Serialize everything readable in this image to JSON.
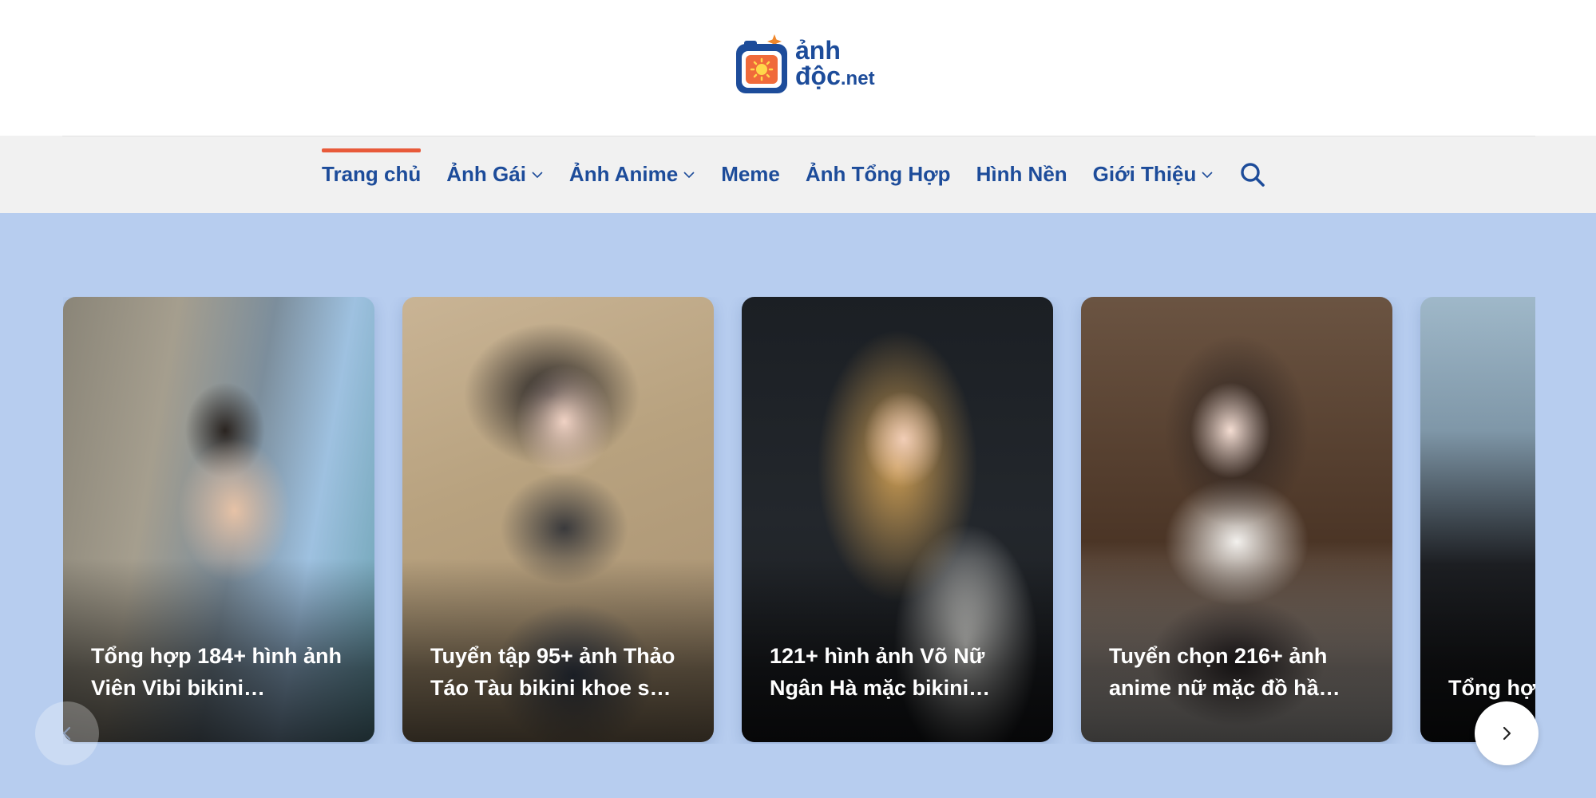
{
  "site": {
    "logo_line1": "ảnh",
    "logo_line2": "độc",
    "logo_tld": ".net"
  },
  "nav": {
    "items": [
      {
        "label": "Trang chủ",
        "active": true,
        "dropdown": false
      },
      {
        "label": "Ảnh Gái",
        "active": false,
        "dropdown": true
      },
      {
        "label": "Ảnh Anime",
        "active": false,
        "dropdown": true
      },
      {
        "label": "Meme",
        "active": false,
        "dropdown": false
      },
      {
        "label": "Ảnh Tổng Hợp",
        "active": false,
        "dropdown": false
      },
      {
        "label": "Hình Nền",
        "active": false,
        "dropdown": false
      },
      {
        "label": "Giới Thiệu",
        "active": false,
        "dropdown": true
      }
    ],
    "search_icon": "search-icon"
  },
  "carousel": {
    "cards": [
      {
        "title": "Tổng hợp 184+ hình ảnh Viên Vibi bikini…"
      },
      {
        "title": "Tuyển tập 95+ ảnh Thảo Táo Tàu bikini khoe s…"
      },
      {
        "title": "121+ hình ảnh Võ Nữ Ngân Hà mặc bikini…"
      },
      {
        "title": "Tuyển chọn 216+ ảnh anime nữ mặc đồ hầ…"
      },
      {
        "title": "Tổng hợp Linh Ngọ…"
      }
    ],
    "prev_icon": "chevron-left-icon",
    "next_icon": "chevron-right-icon"
  },
  "colors": {
    "brand_blue": "#1d4c9a",
    "accent_orange": "#e85a3a",
    "nav_bg": "#f1f1f1",
    "carousel_bg": "#b7cdef"
  }
}
